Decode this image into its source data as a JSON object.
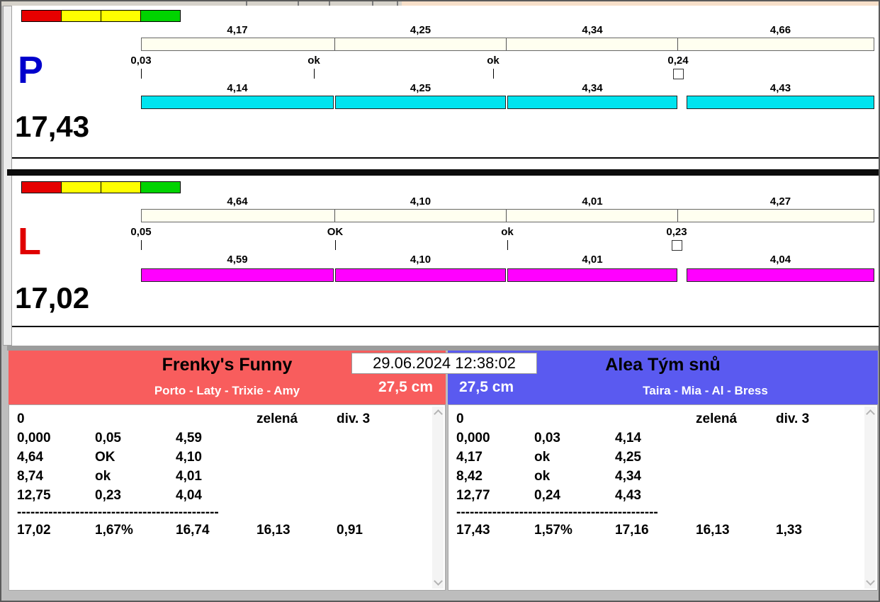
{
  "chrome": {
    "desktop_strip_color": "#f7dfc9"
  },
  "traffic_light": [
    "#e60000",
    "#ffff00",
    "#ffff00",
    "#00d300"
  ],
  "lanes": [
    {
      "letter": "P",
      "letter_color": "#0000cc",
      "splits_top": [
        "4,17",
        "4,25",
        "4,34",
        "4,66"
      ],
      "markers": [
        "0,03",
        "ok",
        "ok",
        "0,24"
      ],
      "splits_bottom": [
        "4,14",
        "4,25",
        "4,34",
        "4,43"
      ],
      "bar_color": "#00e4ef",
      "total": "17,43"
    },
    {
      "letter": "L",
      "letter_color": "#e00000",
      "splits_top": [
        "4,64",
        "4,10",
        "4,01",
        "4,27"
      ],
      "markers": [
        "0,05",
        "OK",
        "ok",
        "0,23"
      ],
      "splits_bottom": [
        "4,59",
        "4,10",
        "4,01",
        "4,04"
      ],
      "bar_color": "#ff00ff",
      "total": "17,02"
    }
  ],
  "timestamp": "29.06.2024 12:38:02",
  "teams": [
    {
      "name": "Frenky's Funny",
      "members": "Porto - Laty - Trixie - Amy",
      "size": "27,5 cm",
      "header_color": "#f85d5d",
      "header_row": [
        "0",
        "zelená",
        "div. 3"
      ],
      "rows": [
        [
          "0,000",
          "0,05",
          "4,59"
        ],
        [
          "4,64",
          "OK",
          "4,10"
        ],
        [
          "8,74",
          "ok",
          "4,01"
        ],
        [
          "12,75",
          "0,23",
          "4,04"
        ]
      ],
      "separator": "---------------------------------------------",
      "summary": [
        "17,02",
        "1,67%",
        "16,74",
        "16,13",
        "0,91"
      ]
    },
    {
      "name": "Alea Tým snů",
      "members": "Taira - Mia - Al - Bress",
      "size": "27,5 cm",
      "header_color": "#5a5af0",
      "header_row": [
        "0",
        "zelená",
        "div. 3"
      ],
      "rows": [
        [
          "0,000",
          "0,03",
          "4,14"
        ],
        [
          "4,17",
          "ok",
          "4,25"
        ],
        [
          "8,42",
          "ok",
          "4,34"
        ],
        [
          "12,77",
          "0,24",
          "4,43"
        ]
      ],
      "separator": "---------------------------------------------",
      "summary": [
        "17,43",
        "1,57%",
        "17,16",
        "16,13",
        "1,33"
      ]
    }
  ]
}
